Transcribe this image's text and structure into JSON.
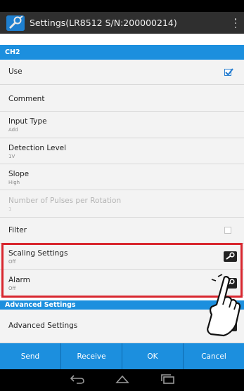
{
  "window": {
    "title": "Settings(LR8512 S/N:200000214)"
  },
  "sections": {
    "ch2": "CH2",
    "advanced": "Advanced Settings"
  },
  "rows": {
    "use": {
      "label": "Use",
      "checked": true
    },
    "comment": {
      "label": "Comment"
    },
    "input_type": {
      "label": "Input Type",
      "value": "Add"
    },
    "detection_level": {
      "label": "Detection Level",
      "value": "1V"
    },
    "slope": {
      "label": "Slope",
      "value": "High"
    },
    "pulses": {
      "label": "Number of Pulses per Rotation",
      "value": "1",
      "enabled": false
    },
    "filter": {
      "label": "Filter",
      "checked": false
    },
    "scaling": {
      "label": "Scaling Settings",
      "value": "Off"
    },
    "alarm": {
      "label": "Alarm",
      "value": "Off"
    },
    "advanced": {
      "label": "Advanced Settings"
    }
  },
  "buttons": {
    "send": "Send",
    "receive": "Receive",
    "ok": "OK",
    "cancel": "Cancel"
  },
  "icons": {
    "app": "settings-app-icon",
    "overflow": "overflow-menu-icon",
    "wrench": "wrench-icon",
    "check": "check-icon",
    "back": "back-icon",
    "home": "home-icon",
    "recents": "recents-icon",
    "pointer": "pointing-hand-icon"
  },
  "colors": {
    "accent": "#1c8fde",
    "highlight": "#d8262e",
    "action_bar": "#2f2f2f"
  }
}
